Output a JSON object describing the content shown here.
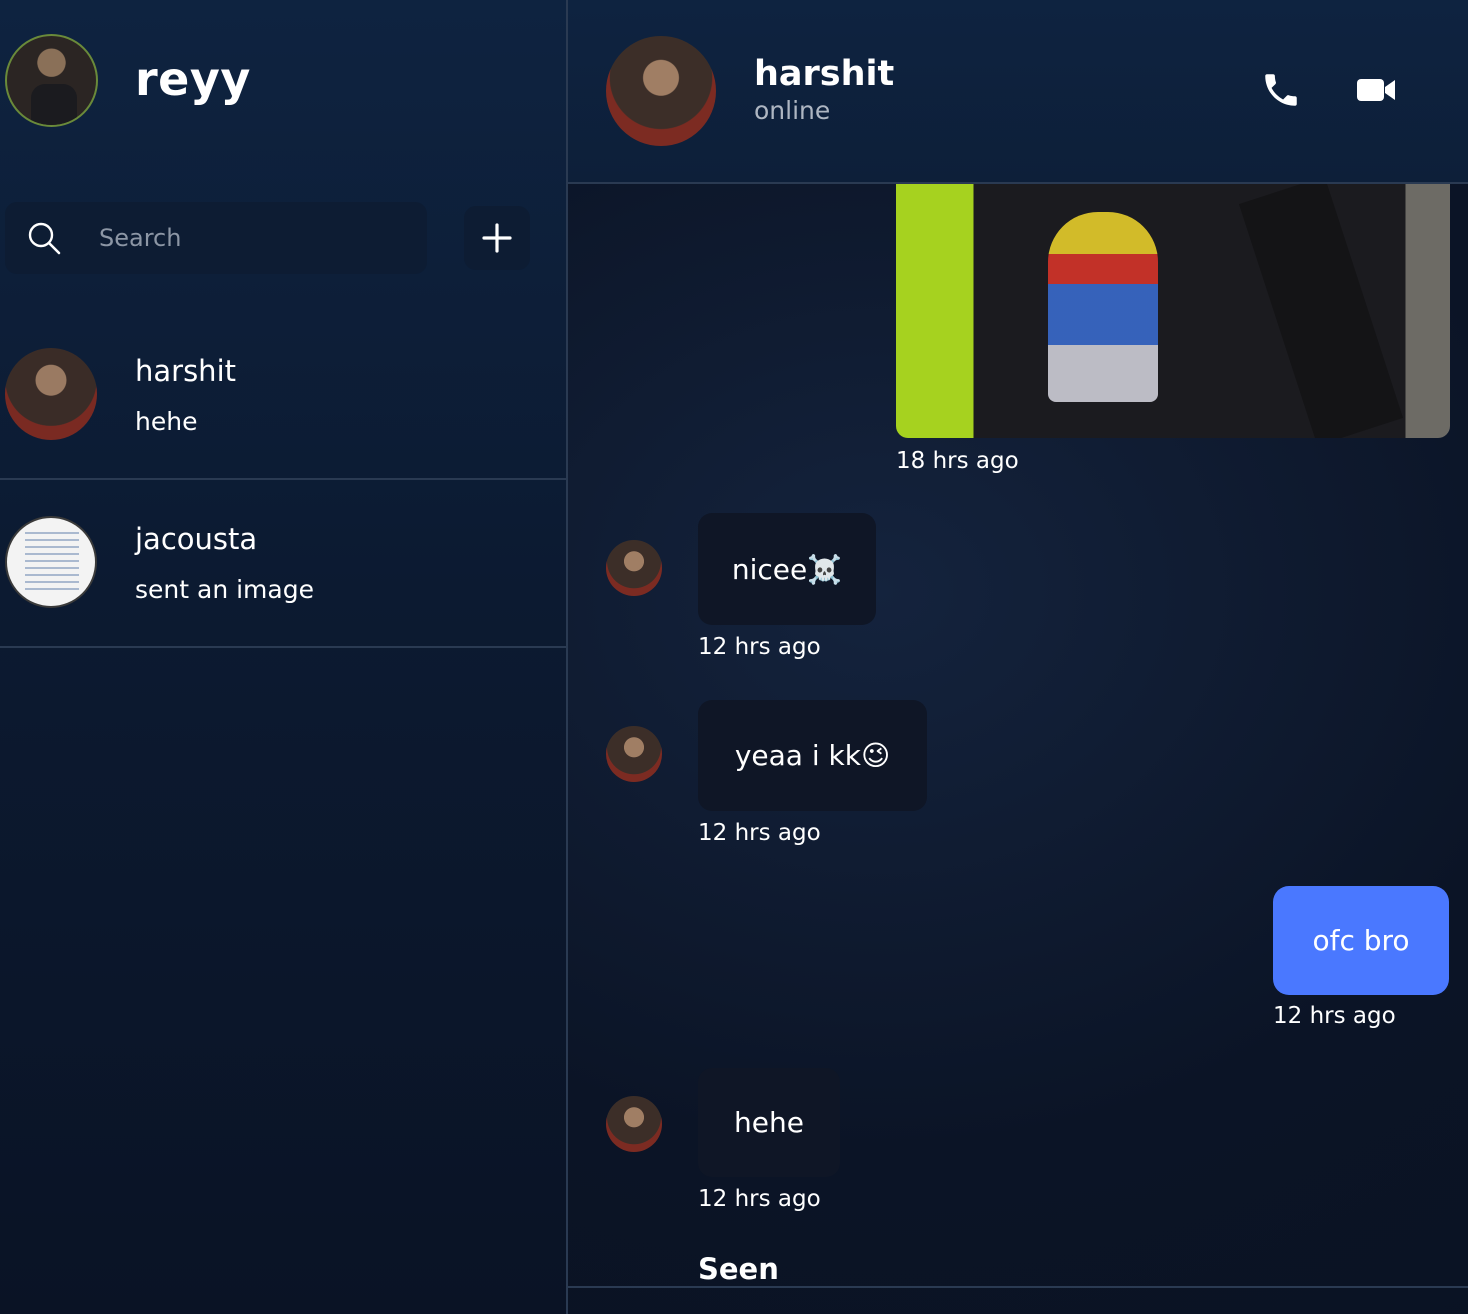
{
  "me": {
    "name": "reyy"
  },
  "search": {
    "placeholder": "Search"
  },
  "conversations": [
    {
      "name": "harshit",
      "preview": "hehe"
    },
    {
      "name": "jacousta",
      "preview": "sent an image"
    }
  ],
  "chat": {
    "peer": {
      "name": "harshit",
      "status": "online"
    },
    "messages": [
      {
        "type": "image",
        "time": "18 hrs ago"
      },
      {
        "type": "in",
        "text": "nicee☠️",
        "time": "12 hrs ago"
      },
      {
        "type": "in",
        "text": "yeaa i kk😉",
        "time": "12 hrs ago"
      },
      {
        "type": "out",
        "text": "ofc bro",
        "time": "12 hrs ago"
      },
      {
        "type": "in",
        "text": "hehe",
        "time": "12 hrs ago"
      }
    ],
    "seen_label": "Seen"
  },
  "icons": {
    "search": "search-icon",
    "add": "plus-icon",
    "call": "phone-icon",
    "video": "video-camera-icon"
  },
  "colors": {
    "accent": "#4a78ff",
    "incoming_bubble": "#0f1626",
    "divider": "#2a3a52"
  }
}
